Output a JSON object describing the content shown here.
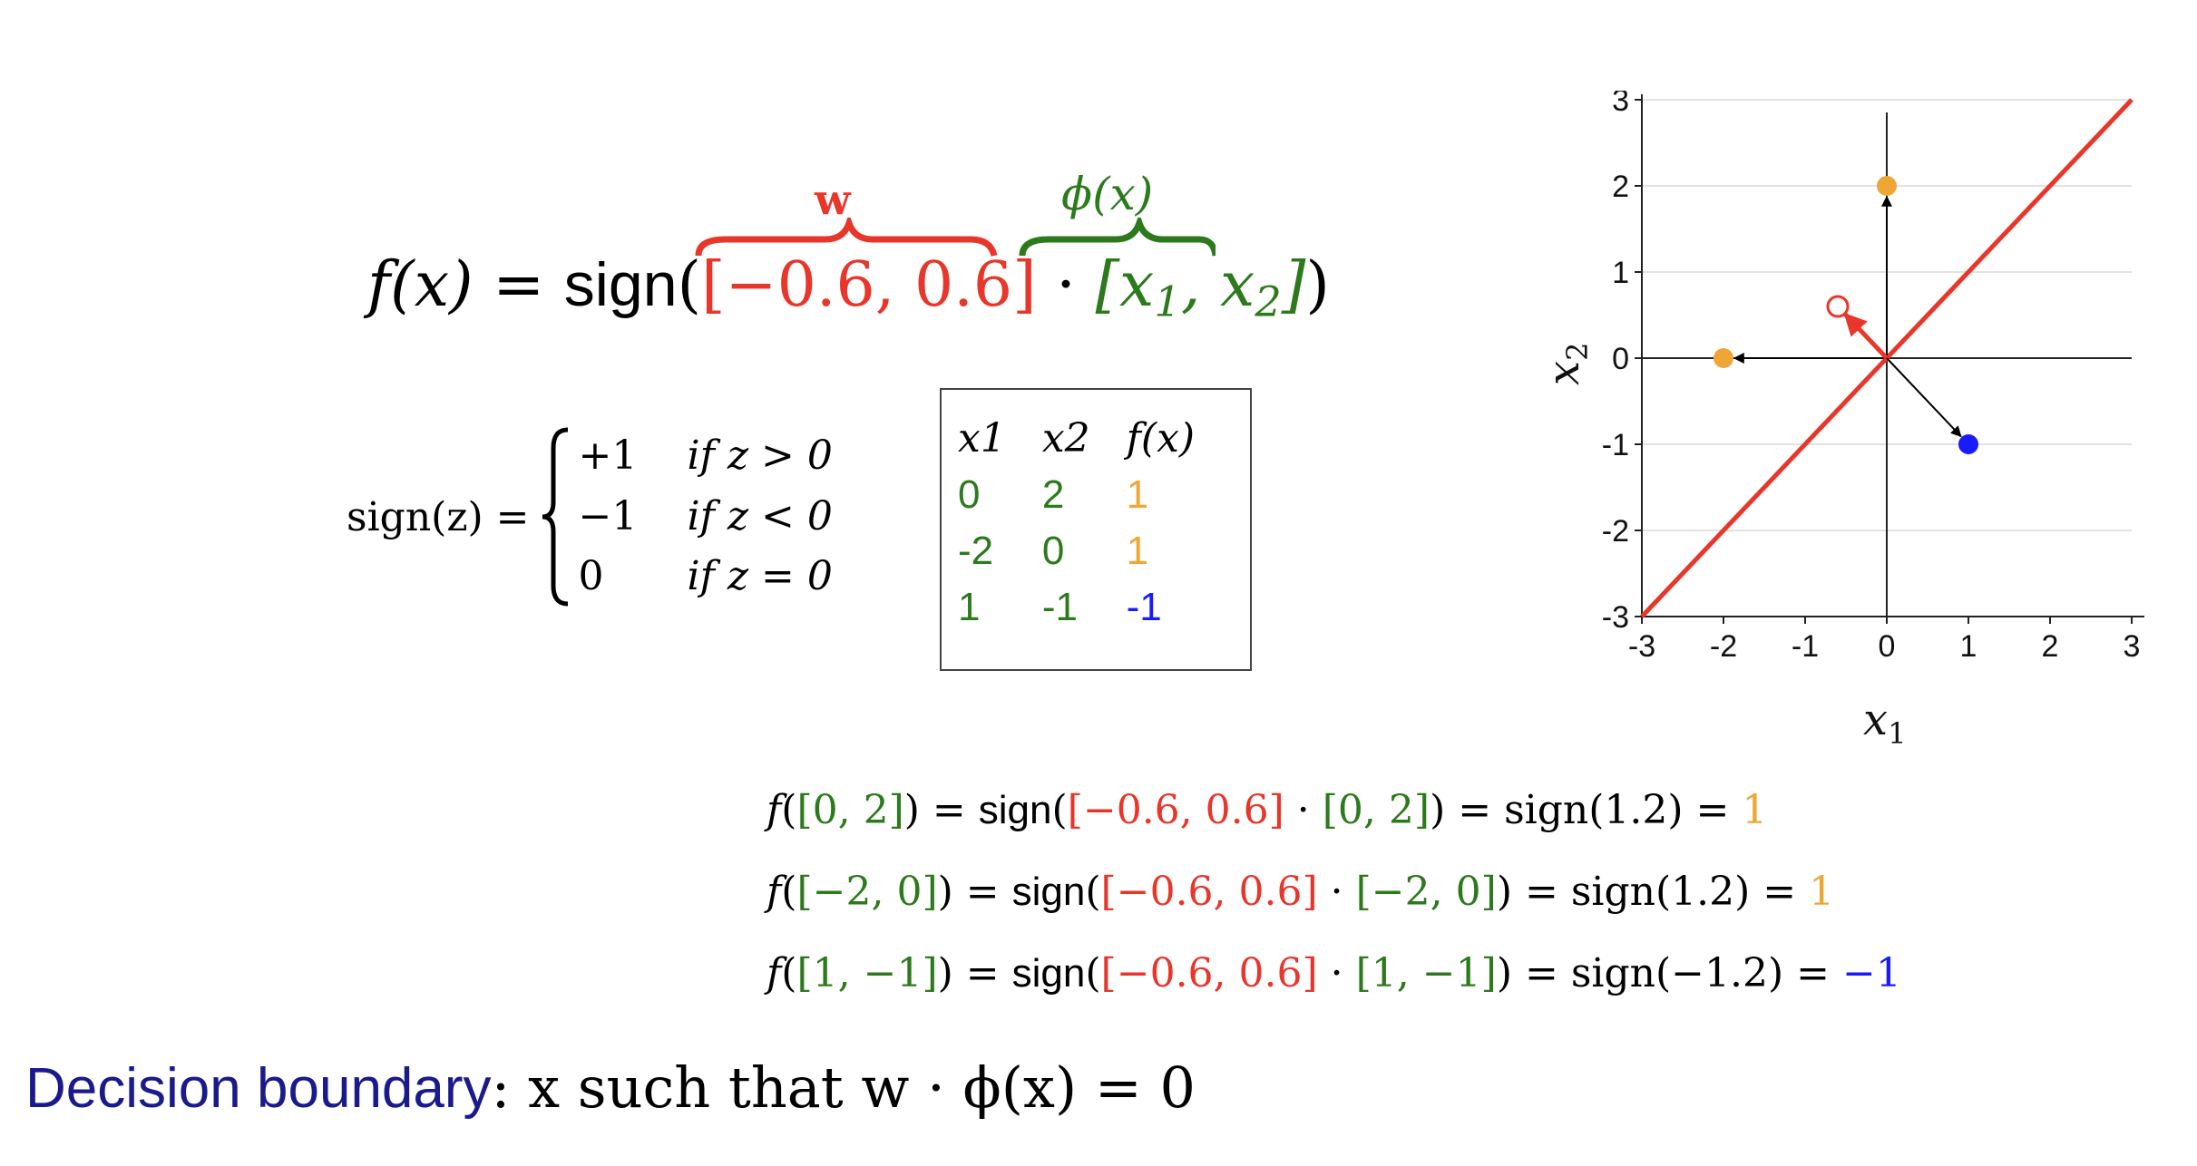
{
  "formula": {
    "lhs": "f(x) = ",
    "sign_word": "sign",
    "w_vector": "[−0.6, 0.6]",
    "dot": "·",
    "phi_vector_open": "[x",
    "phi_vector_sub1": "1",
    "phi_vector_mid": ", x",
    "phi_vector_sub2": "2",
    "phi_vector_close": "]",
    "w_label": "w",
    "phi_label": "ϕ(x)"
  },
  "sign_definition": {
    "lhs": "sign(z) =",
    "cases": [
      {
        "value": "+1",
        "condition": "if z > 0"
      },
      {
        "value": "−1",
        "condition": "if z < 0"
      },
      {
        "value": "0",
        "condition": "if z = 0"
      }
    ]
  },
  "table": {
    "headers": [
      "x1",
      "x2",
      "f(x)"
    ],
    "rows": [
      {
        "x1": "0",
        "x2": "2",
        "fx": "1"
      },
      {
        "x1": "-2",
        "x2": "0",
        "fx": "1"
      },
      {
        "x1": "1",
        "x2": "-1",
        "fx": "-1"
      }
    ]
  },
  "computations": [
    {
      "input": "[0, 2]",
      "w": "[−0.6, 0.6]",
      "sum": "sign(1.2)",
      "result": "1"
    },
    {
      "input": "[−2, 0]",
      "w": "[−0.6, 0.6]",
      "sum": "sign(1.2)",
      "result": "1"
    },
    {
      "input": "[1, −1]",
      "w": "[−0.6, 0.6]",
      "sum": "sign(−1.2)",
      "result": "−1"
    }
  ],
  "boundary": {
    "label": "Decision boundary",
    "text": ": x such that w · ϕ(x) = 0"
  },
  "colors": {
    "weight": "#e8362a",
    "feature": "#2c7a1c",
    "positive": "#f0a637",
    "negative": "#1a1aff",
    "heading": "#1a1a8c"
  },
  "chart_data": {
    "type": "scatter",
    "xlabel": "x1",
    "ylabel": "x2",
    "xlim": [
      -3,
      3
    ],
    "ylim": [
      -3,
      3
    ],
    "x_ticks": [
      "-3",
      "-2",
      "-1",
      "0",
      "1",
      "2",
      "3"
    ],
    "y_ticks": [
      "-3",
      "-2",
      "-1",
      "0",
      "1",
      "2",
      "3"
    ],
    "grid": true,
    "points": [
      {
        "x": 0,
        "y": 2,
        "label": "1",
        "color": "#f0a637"
      },
      {
        "x": -2,
        "y": 0,
        "label": "1",
        "color": "#f0a637"
      },
      {
        "x": 1,
        "y": -1,
        "label": "-1",
        "color": "#1a1aff"
      }
    ],
    "weight_vector": {
      "x": -0.6,
      "y": 0.6,
      "color": "#e8362a"
    },
    "decision_boundary": {
      "from": [
        -3,
        -3
      ],
      "to": [
        3,
        3
      ],
      "color": "#e8362a"
    }
  }
}
